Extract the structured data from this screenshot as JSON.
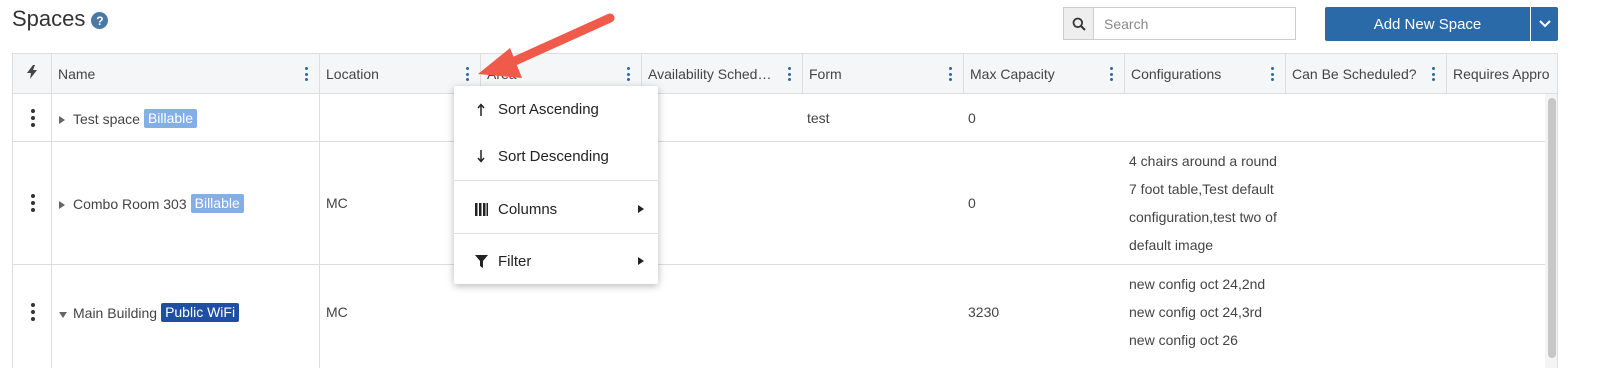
{
  "page": {
    "title": "Spaces",
    "help_icon": "question-circle-icon",
    "help_glyph": "?"
  },
  "search": {
    "placeholder": "Search",
    "value": "",
    "icon": "search-icon"
  },
  "add_button": {
    "label": "Add New Space",
    "dropdown_icon": "chevron-down-icon"
  },
  "columns": [
    {
      "id": "actions",
      "icon": "bolt-icon"
    },
    {
      "id": "name",
      "label": "Name"
    },
    {
      "id": "location",
      "label": "Location"
    },
    {
      "id": "area",
      "label": "Area"
    },
    {
      "id": "availability",
      "label": "Availability Sched…"
    },
    {
      "id": "form",
      "label": "Form"
    },
    {
      "id": "max_capacity",
      "label": "Max Capacity"
    },
    {
      "id": "configurations",
      "label": "Configurations"
    },
    {
      "id": "can_be_scheduled",
      "label": "Can Be Scheduled?"
    },
    {
      "id": "requires_approval",
      "label": "Requires Appro"
    }
  ],
  "rows": [
    {
      "name": "Test space",
      "expand_icon": "caret-right-icon",
      "expanded": false,
      "badge": {
        "text": "Billable",
        "color": "#84aee6"
      },
      "location": "",
      "form": "test",
      "max_capacity": "0",
      "configurations": []
    },
    {
      "name": "Combo Room 303",
      "expand_icon": "caret-right-icon",
      "expanded": false,
      "badge": {
        "text": "Billable",
        "color": "#84aee6"
      },
      "location": "MC",
      "form": "",
      "max_capacity": "0",
      "configurations": [
        "4 chairs around a round",
        "7 foot table,Test default",
        "configuration,test two of",
        "default image"
      ]
    },
    {
      "name": "Main Building",
      "expand_icon": "caret-down-icon",
      "expanded": true,
      "badge": {
        "text": "Public WiFi",
        "color": "#1f4fa3"
      },
      "location": "MC",
      "form": "",
      "max_capacity": "3230",
      "configurations": [
        "new config oct 24,2nd",
        "new config oct 24,3rd",
        "new config oct 26"
      ]
    }
  ],
  "column_menu": {
    "items": [
      {
        "label": "Sort Ascending",
        "icon": "arrow-up-icon",
        "submenu": false
      },
      {
        "label": "Sort Descending",
        "icon": "arrow-down-icon",
        "submenu": false
      },
      {
        "label": "Columns",
        "icon": "columns-icon",
        "submenu": true
      },
      {
        "label": "Filter",
        "icon": "filter-icon",
        "submenu": true
      }
    ]
  },
  "annotation": {
    "type": "arrow",
    "color": "#f05a4a"
  },
  "colors": {
    "accent": "#2b6aa8",
    "kebab": "#2b6aa8"
  }
}
